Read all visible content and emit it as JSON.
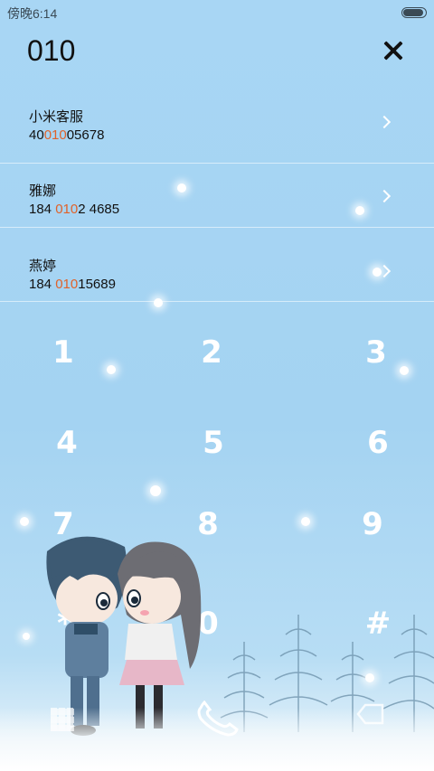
{
  "status_bar": {
    "time": "傍晚6:14",
    "battery_level": 0.9
  },
  "search": {
    "query": "010"
  },
  "results": [
    {
      "name": "小米客服",
      "number_pre": "40",
      "number_hl": "010",
      "number_post": "05678"
    },
    {
      "name": "雅娜",
      "number_pre": "184 ",
      "number_hl": "010",
      "number_post": "2 4685"
    },
    {
      "name": "燕婷",
      "number_pre": "184 ",
      "number_hl": "010",
      "number_post": "15689"
    }
  ],
  "dialpad": {
    "keys": [
      "1",
      "2",
      "3",
      "4",
      "5",
      "6",
      "7",
      "8",
      "9",
      "*",
      "0",
      "#"
    ]
  },
  "colors": {
    "highlight": "#e0622a",
    "background": "#a8d6f4"
  }
}
